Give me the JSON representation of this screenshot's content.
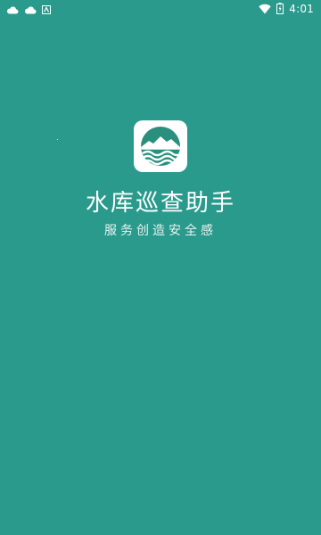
{
  "status_bar": {
    "time": "4:01",
    "icons": [
      "cloud-icon",
      "cloud-icon",
      "notification-icon",
      "wifi-icon",
      "battery-icon"
    ]
  },
  "splash": {
    "title": "水库巡查助手",
    "slogan": "服务创造安全感",
    "icon": "reservoir-logo-icon",
    "background_color": "#2a9a8c"
  }
}
